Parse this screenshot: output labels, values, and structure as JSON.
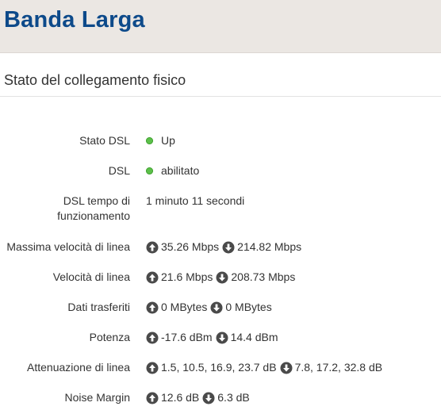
{
  "header": {
    "title": "Banda Larga"
  },
  "section": {
    "title": "Stato del collegamento fisico"
  },
  "rows": {
    "dsl_state": {
      "label": "Stato DSL",
      "value": "Up",
      "status_color": "#5cc04a"
    },
    "dsl": {
      "label": "DSL",
      "value": "abilitato",
      "status_color": "#5cc04a"
    },
    "uptime": {
      "label_line1": "DSL tempo di",
      "label_line2": "funzionamento",
      "value": "1 minuto 11 secondi"
    },
    "max_speed": {
      "label": "Massima velocità di linea",
      "up": "35.26 Mbps",
      "down": "214.82 Mbps"
    },
    "speed": {
      "label": "Velocità di linea",
      "up": "21.6 Mbps",
      "down": "208.73 Mbps"
    },
    "data": {
      "label": "Dati trasferiti",
      "up": "0 MBytes",
      "down": "0 MBytes"
    },
    "power": {
      "label": "Potenza",
      "up": "-17.6 dBm",
      "down": "14.4 dBm"
    },
    "attenuation": {
      "label": "Attenuazione di linea",
      "up": "1.5, 10.5, 16.9, 23.7 dB",
      "down": "7.8, 17.2, 32.8 dB"
    },
    "noise": {
      "label": "Noise Margin",
      "up": "12.6 dB",
      "down": "6.3 dB"
    }
  },
  "icons": {
    "up": "arrow-up-circle-icon",
    "down": "arrow-down-circle-icon",
    "status": "status-dot-icon"
  },
  "colors": {
    "title": "#0d4a8a",
    "header_bg": "#ebe7e3",
    "icon": "#4a4a4a",
    "status_ok": "#5cc04a"
  }
}
